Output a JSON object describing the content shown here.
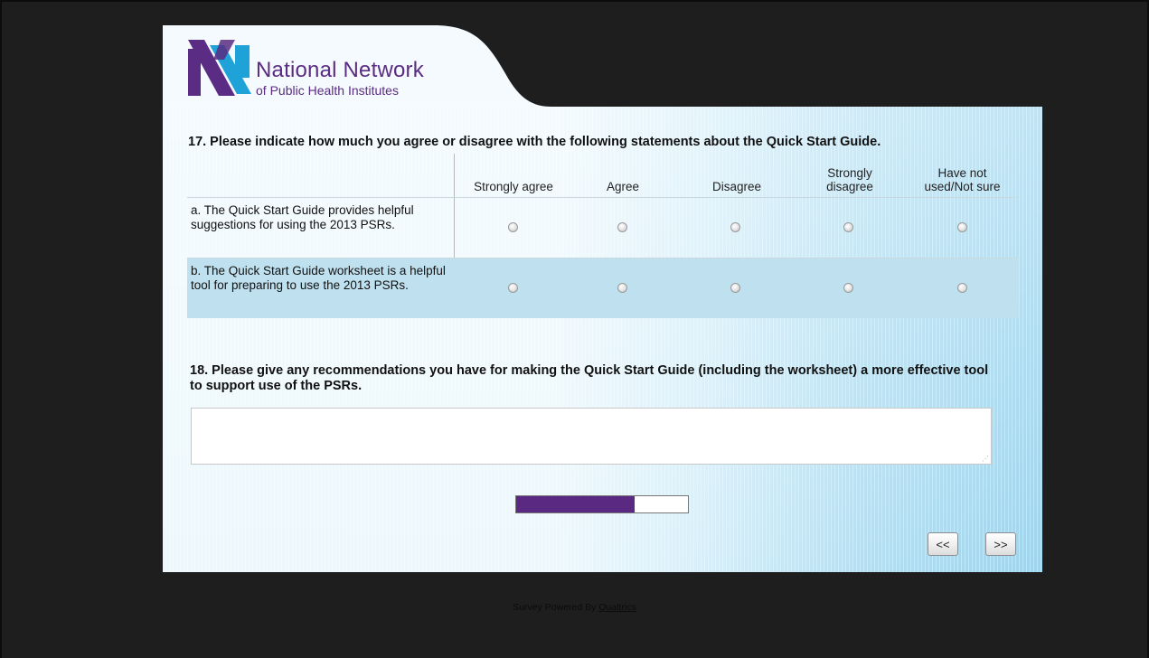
{
  "header": {
    "org_line1": "National Network",
    "org_line2": "of Public Health Institutes",
    "brand_color": "#5b2c83",
    "logo_blue": "#1ea2d7"
  },
  "q17": {
    "title": "17. Please indicate how much you agree or disagree with the following statements about the Quick Start Guide.",
    "columns": [
      {
        "line1": "",
        "line2": "Strongly agree"
      },
      {
        "line1": "",
        "line2": "Agree"
      },
      {
        "line1": "",
        "line2": "Disagree"
      },
      {
        "line1": "Strongly",
        "line2": "disagree"
      },
      {
        "line1": "Have not",
        "line2": "used/Not sure"
      }
    ],
    "rows": [
      {
        "label": "a. The Quick Start Guide provides helpful suggestions for using the 2013 PSRs."
      },
      {
        "label": "b. The Quick Start Guide worksheet is a helpful tool for preparing to use the 2013 PSRs."
      }
    ]
  },
  "q18": {
    "title": "18. Please give any recommendations you have for making the Quick Start Guide (including the worksheet) a more effective tool to support use of the PSRs.",
    "answer_value": ""
  },
  "progress": {
    "fraction": 0.69,
    "fill_color": "#5a2a82"
  },
  "nav": {
    "back_label": "<<",
    "next_label": ">>"
  },
  "footer": {
    "prefix": "Survey Powered By",
    "link": "Qualtrics"
  }
}
